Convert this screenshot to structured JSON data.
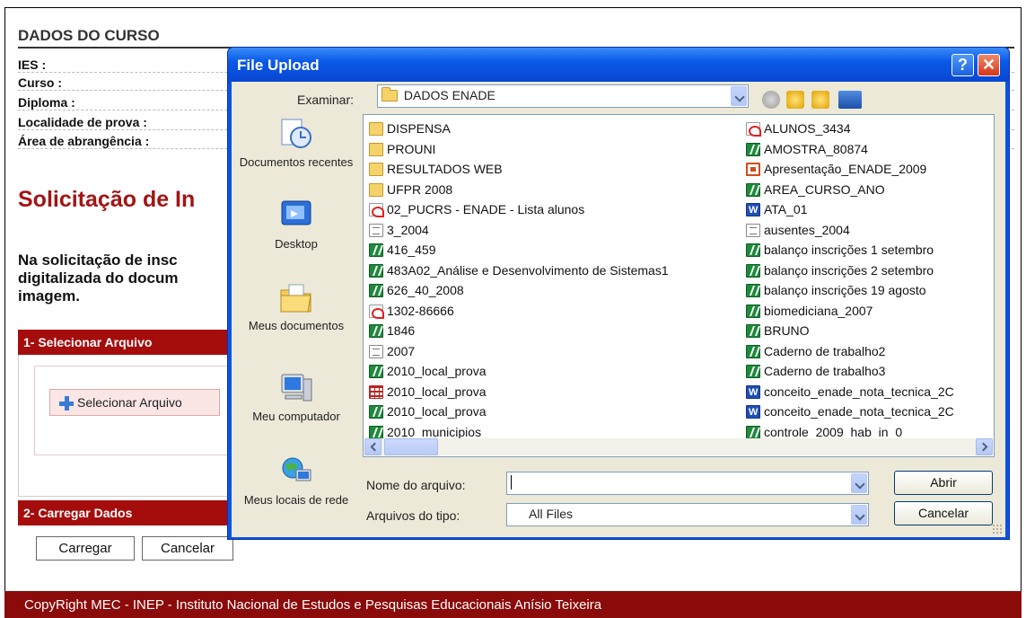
{
  "page": {
    "section_title": "DADOS DO CURSO",
    "fields": [
      {
        "label": "IES :"
      },
      {
        "label": "Curso :"
      },
      {
        "label": "Diploma :"
      },
      {
        "label": "Localidade de prova :"
      },
      {
        "label": "Área de abrangência :"
      }
    ],
    "heading": "Solicitação de In",
    "paragraph": "Na solicitação de insc\ndigitalizada do docum\nimagem.",
    "panel1": {
      "title": "1- Selecionar Arquivo",
      "select_button": "Selecionar Arquivo"
    },
    "panel2": {
      "title": "2- Carregar Dados"
    },
    "buttons": {
      "load": "Carregar",
      "cancel": "Cancelar"
    },
    "footer": "CopyRight MEC - INEP - Instituto Nacional de Estudos e Pesquisas Educacionais Anísio Teixeira",
    "colors": {
      "brand": "#a50d0d",
      "footer": "#8b0a0a",
      "dialog_title": "#0a54e3"
    }
  },
  "dialog": {
    "title": "File Upload",
    "help": "?",
    "close": "✕",
    "look_in_label": "Examinar:",
    "look_in_value": "DADOS ENADE",
    "places": [
      {
        "label": "Documentos recentes",
        "icon": "recent-documents-icon"
      },
      {
        "label": "Desktop",
        "icon": "desktop-icon"
      },
      {
        "label": "Meus documentos",
        "icon": "my-documents-icon"
      },
      {
        "label": "Meu computador",
        "icon": "my-computer-icon"
      },
      {
        "label": "Meus locais de rede",
        "icon": "network-places-icon"
      }
    ],
    "files_col1": [
      {
        "name": "DISPENSA",
        "type": "folder"
      },
      {
        "name": "PROUNI",
        "type": "folder"
      },
      {
        "name": "RESULTADOS WEB",
        "type": "folder"
      },
      {
        "name": "UFPR 2008",
        "type": "folder"
      },
      {
        "name": "02_PUCRS - ENADE - Lista alunos",
        "type": "pdf"
      },
      {
        "name": "3_2004",
        "type": "txt"
      },
      {
        "name": "416_459",
        "type": "xls"
      },
      {
        "name": "483A02_Análise e Desenvolvimento de Sistemas1",
        "type": "xls"
      },
      {
        "name": "626_40_2008",
        "type": "xls"
      },
      {
        "name": "1302-86666",
        "type": "pdf"
      },
      {
        "name": "1846",
        "type": "xls"
      },
      {
        "name": "2007",
        "type": "txt"
      },
      {
        "name": "2010_local_prova",
        "type": "xls"
      },
      {
        "name": "2010_local_prova",
        "type": "grid"
      },
      {
        "name": "2010_local_prova",
        "type": "xls"
      },
      {
        "name": "2010_municipios",
        "type": "xls"
      }
    ],
    "files_col2": [
      {
        "name": "ALUNOS_3434",
        "type": "pdf"
      },
      {
        "name": "AMOSTRA_80874",
        "type": "xls"
      },
      {
        "name": "Apresentação_ENADE_2009",
        "type": "ppt"
      },
      {
        "name": "AREA_CURSO_ANO",
        "type": "xls"
      },
      {
        "name": "ATA_01",
        "type": "doc"
      },
      {
        "name": "ausentes_2004",
        "type": "txt"
      },
      {
        "name": "balanço inscrições 1 setembro",
        "type": "xls"
      },
      {
        "name": "balanço inscrições 2 setembro",
        "type": "xls"
      },
      {
        "name": "balanço inscrições 19 agosto",
        "type": "xls"
      },
      {
        "name": "biomediciana_2007",
        "type": "xls"
      },
      {
        "name": "BRUNO",
        "type": "xls"
      },
      {
        "name": "Caderno de trabalho2",
        "type": "xls"
      },
      {
        "name": "Caderno de trabalho3",
        "type": "xls"
      },
      {
        "name": "conceito_enade_nota_tecnica_2C",
        "type": "doc"
      },
      {
        "name": "conceito_enade_nota_tecnica_2C",
        "type": "doc"
      },
      {
        "name": "controle_2009_hab_in_0",
        "type": "xls"
      }
    ],
    "filename_label": "Nome do arquivo:",
    "filename_value": "",
    "filetype_label": "Arquivos do tipo:",
    "filetype_value": "All Files",
    "open_button": "Abrir",
    "cancel_button": "Cancelar"
  }
}
